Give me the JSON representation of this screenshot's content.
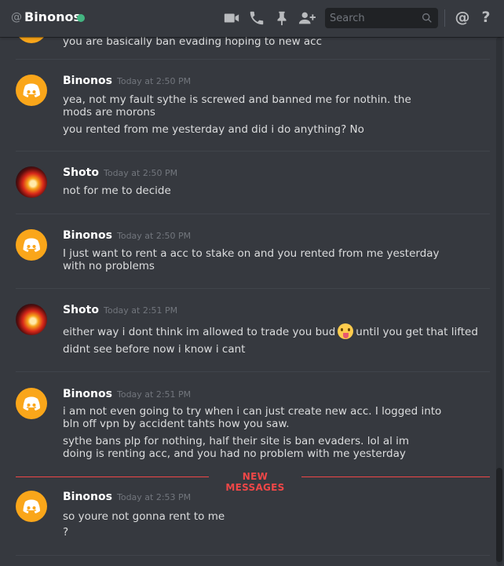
{
  "header": {
    "at_symbol": "@",
    "channel_name": "Binonos",
    "status": "online",
    "status_color": "#43b581",
    "icons": [
      "video-call-icon",
      "voice-call-icon",
      "pin-icon",
      "add-friend-icon",
      "mention-icon",
      "help-icon"
    ],
    "search_placeholder": "Search",
    "mention_symbol": "@",
    "help_symbol": "?"
  },
  "messages": [
    {
      "author": "",
      "timestamp": "",
      "lines": [
        "you are basically ban evading hoping to new acc"
      ]
    },
    {
      "author": "Binonos",
      "timestamp": "Today at 2:50 PM",
      "avatar": "discord-default",
      "lines": [
        "yea, not my fault sythe is screwed and banned me for nothin. the mods are morons",
        "you rented from me yesterday and did i do anything? No"
      ]
    },
    {
      "author": "Shoto",
      "timestamp": "Today at 2:50 PM",
      "avatar": "shoto",
      "lines": [
        "not for me to decide"
      ]
    },
    {
      "author": "Binonos",
      "timestamp": "Today at 2:50 PM",
      "avatar": "discord-default",
      "lines": [
        "I just want to rent a acc to stake on and you rented from me yesterday with no problems"
      ]
    },
    {
      "author": "Shoto",
      "timestamp": "Today at 2:51 PM",
      "avatar": "shoto",
      "lines": [
        "either way i dont think im allowed to trade you bud",
        "until you get that lifted",
        "didnt see before now i know i cant"
      ],
      "emoji": "tongue-out-emoji"
    },
    {
      "author": "Binonos",
      "timestamp": "Today at 2:51 PM",
      "avatar": "discord-default",
      "lines": [
        "i am not even going to try when i can just create new acc. I logged into bln off vpn by accident tahts how you saw.",
        "sythe bans plp for nothing, half their site is ban evaders. lol al im doing is renting acc, and you had no problem with me yesterday"
      ]
    },
    {
      "author": "Binonos",
      "timestamp": "Today at 2:53 PM",
      "avatar": "discord-default",
      "lines": [
        "so youre not gonna rent to me",
        "?"
      ]
    }
  ],
  "new_messages_label": "NEW MESSAGES",
  "colors": {
    "background": "#36393f",
    "header_text": "#ffffff",
    "new_messages": "#f04747",
    "discord_avatar": "#faa61a"
  }
}
